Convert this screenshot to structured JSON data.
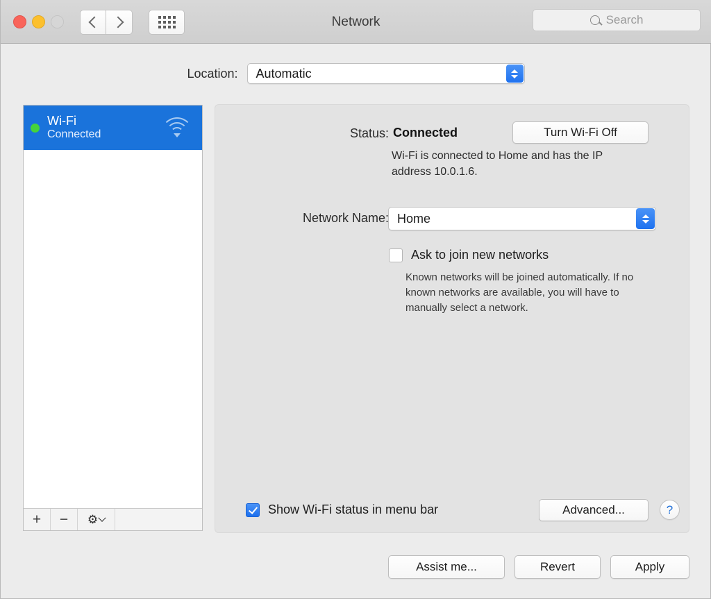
{
  "window": {
    "title": "Network"
  },
  "titlebar": {
    "traffic_lights": [
      {
        "name": "close",
        "color": "#f9645a"
      },
      {
        "name": "minimize",
        "color": "#fcc02e"
      },
      {
        "name": "zoom",
        "color": "#d6d6d6"
      }
    ],
    "back_icon": "chevron-left-icon",
    "forward_icon": "chevron-right-icon",
    "show_all_icon": "grid-icon",
    "search": {
      "placeholder": "Search",
      "value": "",
      "icon": "search-icon"
    }
  },
  "location": {
    "label": "Location:",
    "value": "Automatic",
    "options": [
      "Automatic"
    ]
  },
  "sidebar": {
    "services": [
      {
        "name": "Wi-Fi",
        "status": "Connected",
        "status_color": "#45d33a",
        "selected": true,
        "icon": "wifi-icon"
      }
    ],
    "toolbar": {
      "add_label": "+",
      "remove_label": "−",
      "action_icon": "gear-icon",
      "action_caret_icon": "chevron-down-icon"
    }
  },
  "main": {
    "status_label": "Status:",
    "status_value": "Connected",
    "status_description": "Wi-Fi is connected to Home and has the IP address 10.0.1.6.",
    "turn_off_button": "Turn Wi-Fi Off",
    "network_name_label": "Network Name:",
    "network_name_value": "Home",
    "network_name_options": [
      "Home"
    ],
    "ask_to_join": {
      "label": "Ask to join new networks",
      "checked": false,
      "help_text": "Known networks will be joined automatically. If no known networks are available, you will have to manually select a network."
    },
    "show_menu_bar": {
      "label": "Show Wi-Fi status in menu bar",
      "checked": true
    },
    "advanced_button": "Advanced...",
    "help_button": "?"
  },
  "footer": {
    "assist_button": "Assist me...",
    "revert_button": "Revert",
    "apply_button": "Apply"
  },
  "colors": {
    "accent_blue": "#1a73db",
    "stepper_blue": "#1f72ef",
    "status_green": "#45d33a",
    "window_bg": "#ececec",
    "panel_bg": "#e3e3e3",
    "titlebar_bg": "#d2d2d2"
  }
}
